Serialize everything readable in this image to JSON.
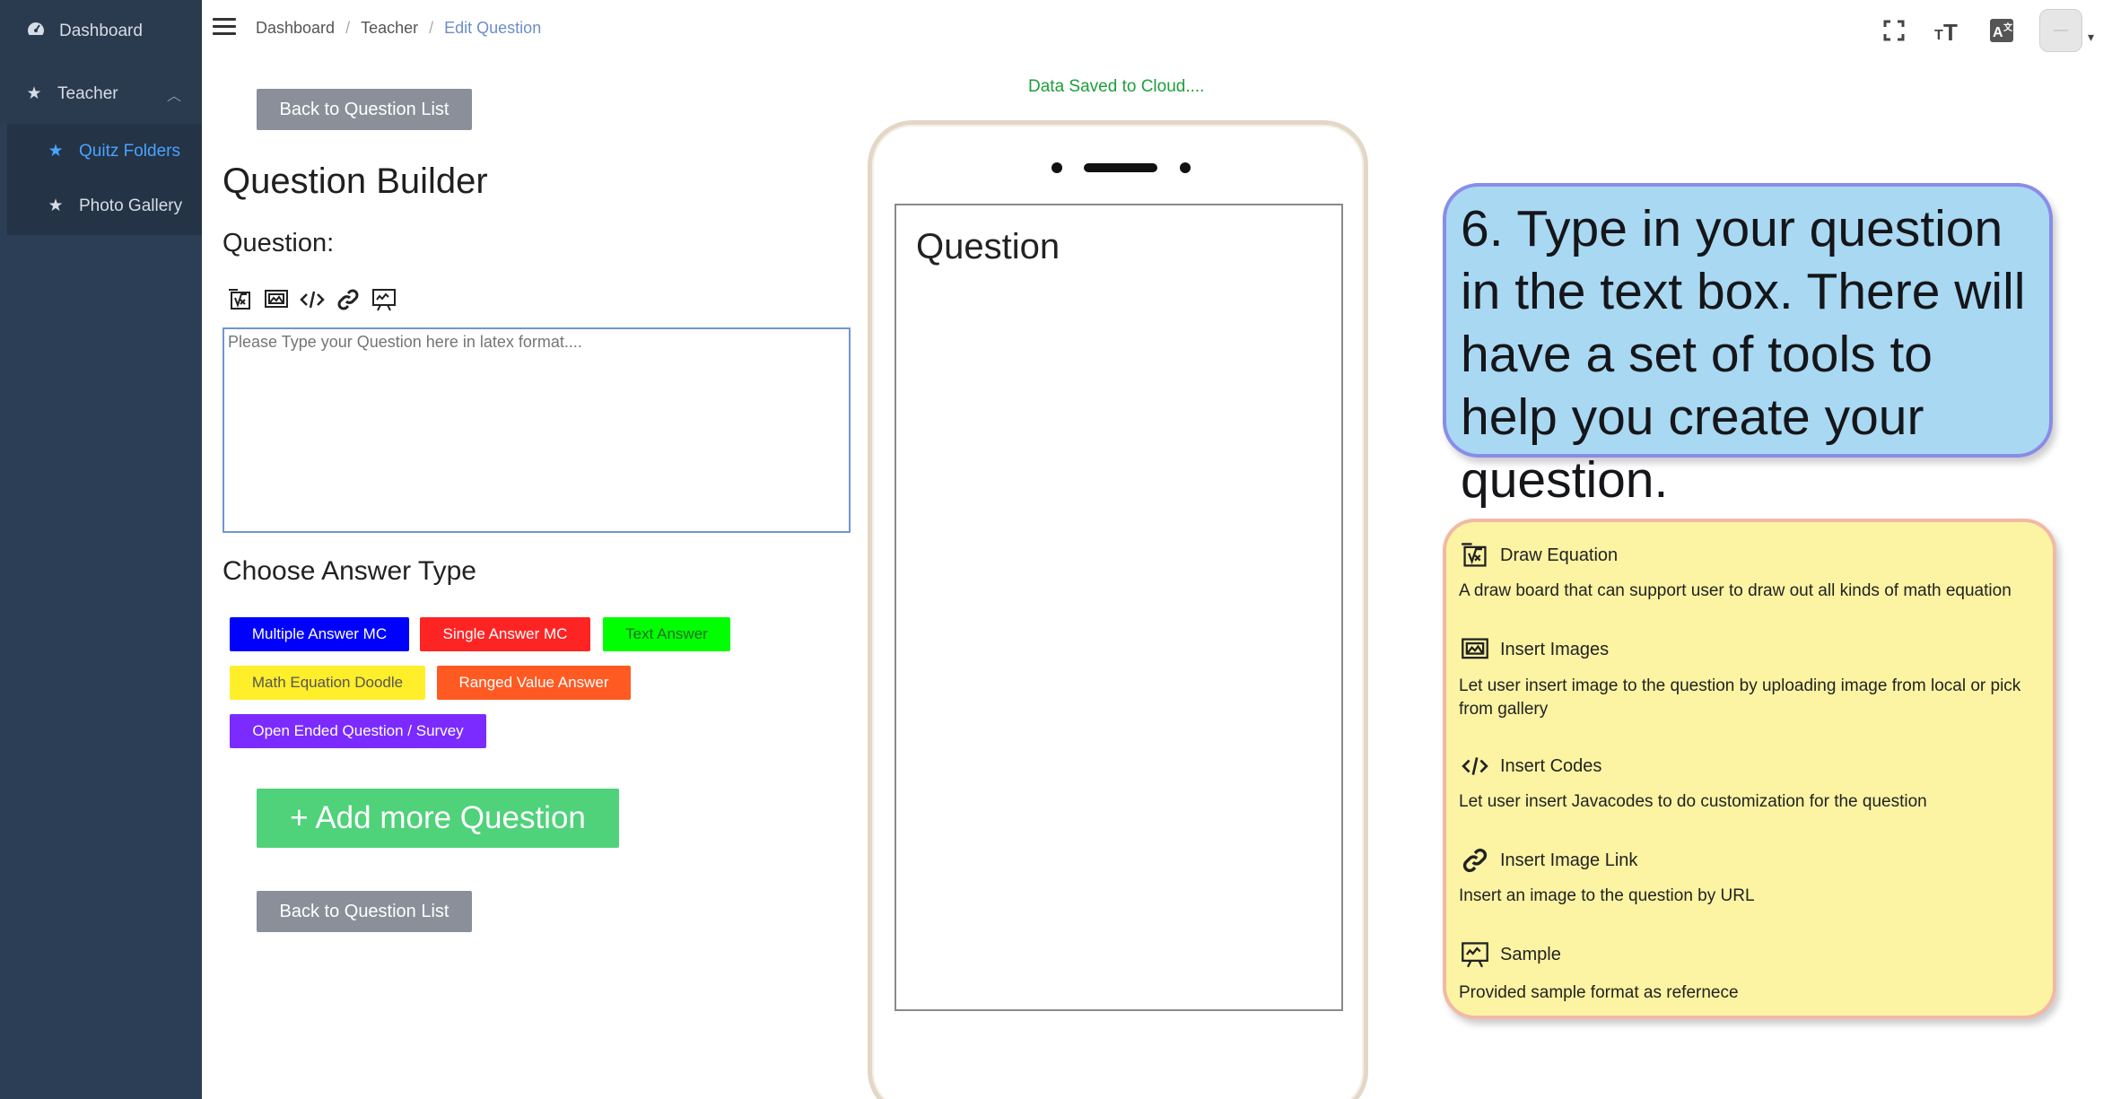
{
  "sidebar": {
    "items": [
      {
        "label": "Dashboard",
        "icon": "dashboard-icon"
      },
      {
        "label": "Teacher",
        "icon": "star-icon"
      },
      {
        "label": "Quitz Folders",
        "icon": "star-icon"
      },
      {
        "label": "Photo Gallery",
        "icon": "star-icon"
      }
    ]
  },
  "breadcrumb": {
    "items": [
      "Dashboard",
      "Teacher",
      "Edit Question"
    ],
    "separator": "/"
  },
  "editor": {
    "back_label": "Back to Question List",
    "title": "Question Builder",
    "question_label": "Question:",
    "placeholder": "Please Type your Question here in latex format....",
    "choose_label": "Choose Answer Type",
    "answer_types": [
      {
        "label": "Multiple Answer MC",
        "color": "#0000ff"
      },
      {
        "label": "Single Answer MC",
        "color": "#ff2424"
      },
      {
        "label": "Text Answer",
        "color": "#00ff00"
      },
      {
        "label": "Math Equation Doodle",
        "color": "#ffee2a"
      },
      {
        "label": "Ranged Value Answer",
        "color": "#ff5a22"
      },
      {
        "label": "Open Ended Question / Survey",
        "color": "#7b2bff"
      }
    ],
    "add_more_label": "+ Add more Question"
  },
  "preview": {
    "status": "Data Saved to Cloud....",
    "question_text": "Question"
  },
  "callout": {
    "text": "6. Type in your question in the text box. There will have a set of tools to help you create your question."
  },
  "features": [
    {
      "title": "Draw Equation",
      "desc": "A draw board that can support user to draw out all kinds of math equation",
      "icon": "draw-equation-icon"
    },
    {
      "title": "Insert Images",
      "desc": "Let user insert image to the question by uploading image from local or pick from gallery",
      "icon": "insert-image-icon"
    },
    {
      "title": "Insert Codes",
      "desc": "Let user insert Javacodes to do customization for the question",
      "icon": "code-icon"
    },
    {
      "title": "Insert Image Link",
      "desc": "Insert an image to the question by URL",
      "icon": "link-icon"
    },
    {
      "title": "Sample",
      "desc": "Provided sample format as refernece",
      "icon": "sample-icon"
    }
  ],
  "colors": {
    "sidebar_bg": "#2c3e55",
    "active_link": "#4aa3ff",
    "add_more": "#4fd27a",
    "back_button": "#8a8f99",
    "saved_status": "#1e9e3a"
  }
}
